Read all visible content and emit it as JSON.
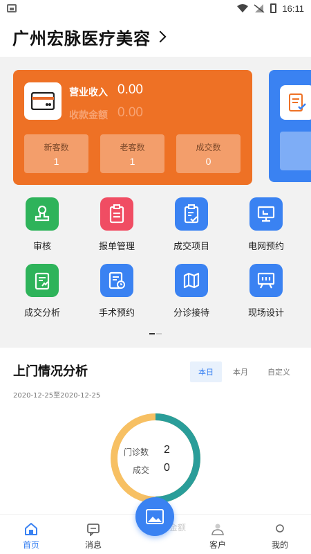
{
  "status_bar": {
    "time": "16:11"
  },
  "header": {
    "title": "广州宏脉医疗美容"
  },
  "revenue_card": {
    "revenue_label": "营业收入",
    "revenue_value": "0.00",
    "collection_label": "收款金额",
    "collection_value": "0.00",
    "stats": [
      {
        "label": "新客数",
        "value": "1"
      },
      {
        "label": "老客数",
        "value": "1"
      },
      {
        "label": "成交数",
        "value": "0"
      }
    ]
  },
  "grid": {
    "items": [
      {
        "label": "审核",
        "icon": "stamp-icon",
        "color": "#2eb35a"
      },
      {
        "label": "报单管理",
        "icon": "clipboard-icon",
        "color": "#f04d63"
      },
      {
        "label": "成交项目",
        "icon": "clipboard-check-icon",
        "color": "#3a82f2"
      },
      {
        "label": "电网预约",
        "icon": "monitor-icon",
        "color": "#3a82f2"
      },
      {
        "label": "成交分析",
        "icon": "document-analysis-icon",
        "color": "#2eb35a"
      },
      {
        "label": "手术预约",
        "icon": "document-clock-icon",
        "color": "#3a82f2"
      },
      {
        "label": "分诊接待",
        "icon": "map-icon",
        "color": "#3a82f2"
      },
      {
        "label": "现场设计",
        "icon": "presentation-board-icon",
        "color": "#3a82f2"
      }
    ]
  },
  "analysis": {
    "title": "上门情况分析",
    "tabs": [
      "本日",
      "本月",
      "自定义"
    ],
    "active_tab": "本日",
    "date_range": "2020-12-25至2020-12-25",
    "donut": {
      "rows": [
        {
          "label": "门诊数",
          "value": "2"
        },
        {
          "label": "成交",
          "value": "0"
        }
      ],
      "fraction_teal": 0.5,
      "colors": {
        "teal": "#2a9d99",
        "yellow": "#f7c063"
      }
    },
    "overlap_text": "金额"
  },
  "bottom_nav": {
    "items": [
      {
        "label": "首页",
        "icon": "home-icon",
        "active": true
      },
      {
        "label": "消息",
        "icon": "message-icon",
        "active": false
      },
      {
        "label": "客户",
        "icon": "customer-icon",
        "active": false
      },
      {
        "label": "我的",
        "icon": "profile-icon",
        "active": false
      }
    ]
  },
  "colors": {
    "accent": "#3a82f2",
    "orange": "#ee7125"
  }
}
